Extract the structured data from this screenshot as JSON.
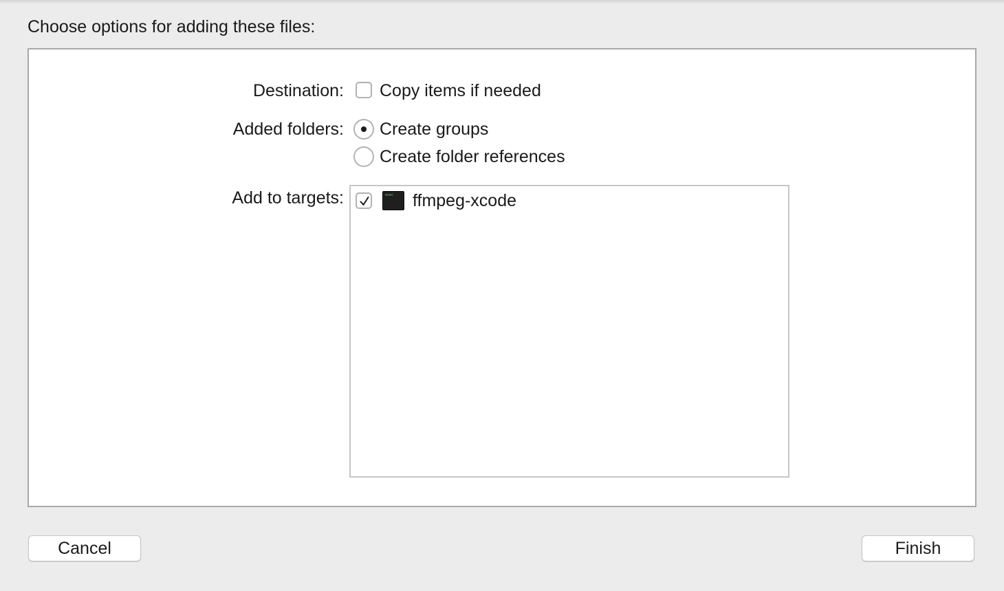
{
  "dialog": {
    "title": "Choose options for adding these files:"
  },
  "destination": {
    "label": "Destination:",
    "copy_items": {
      "label": "Copy items if needed",
      "checked": false
    }
  },
  "added_folders": {
    "label": "Added folders:",
    "options": [
      {
        "label": "Create groups",
        "selected": true
      },
      {
        "label": "Create folder references",
        "selected": false
      }
    ]
  },
  "targets": {
    "label": "Add to targets:",
    "items": [
      {
        "name": "ffmpeg-xcode",
        "checked": true,
        "icon": "terminal-executable-icon",
        "icon_text": "exec"
      }
    ]
  },
  "buttons": {
    "cancel": "Cancel",
    "finish": "Finish"
  },
  "colors": {
    "window_bg": "#ececec",
    "panel_bg": "#ffffff",
    "border": "#a9a9a9"
  }
}
